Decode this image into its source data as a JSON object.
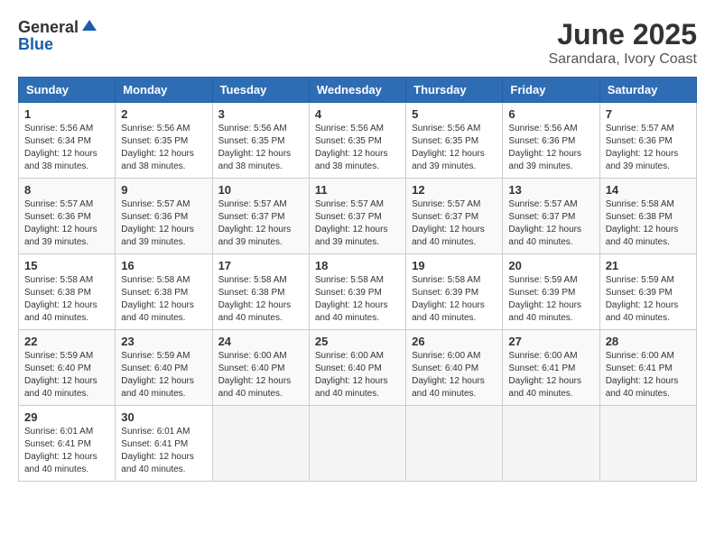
{
  "header": {
    "logo_general": "General",
    "logo_blue": "Blue",
    "title": "June 2025",
    "subtitle": "Sarandara, Ivory Coast"
  },
  "calendar": {
    "days_of_week": [
      "Sunday",
      "Monday",
      "Tuesday",
      "Wednesday",
      "Thursday",
      "Friday",
      "Saturday"
    ],
    "weeks": [
      [
        {
          "day": "1",
          "info": "Sunrise: 5:56 AM\nSunset: 6:34 PM\nDaylight: 12 hours\nand 38 minutes."
        },
        {
          "day": "2",
          "info": "Sunrise: 5:56 AM\nSunset: 6:35 PM\nDaylight: 12 hours\nand 38 minutes."
        },
        {
          "day": "3",
          "info": "Sunrise: 5:56 AM\nSunset: 6:35 PM\nDaylight: 12 hours\nand 38 minutes."
        },
        {
          "day": "4",
          "info": "Sunrise: 5:56 AM\nSunset: 6:35 PM\nDaylight: 12 hours\nand 38 minutes."
        },
        {
          "day": "5",
          "info": "Sunrise: 5:56 AM\nSunset: 6:35 PM\nDaylight: 12 hours\nand 39 minutes."
        },
        {
          "day": "6",
          "info": "Sunrise: 5:56 AM\nSunset: 6:36 PM\nDaylight: 12 hours\nand 39 minutes."
        },
        {
          "day": "7",
          "info": "Sunrise: 5:57 AM\nSunset: 6:36 PM\nDaylight: 12 hours\nand 39 minutes."
        }
      ],
      [
        {
          "day": "8",
          "info": "Sunrise: 5:57 AM\nSunset: 6:36 PM\nDaylight: 12 hours\nand 39 minutes."
        },
        {
          "day": "9",
          "info": "Sunrise: 5:57 AM\nSunset: 6:36 PM\nDaylight: 12 hours\nand 39 minutes."
        },
        {
          "day": "10",
          "info": "Sunrise: 5:57 AM\nSunset: 6:37 PM\nDaylight: 12 hours\nand 39 minutes."
        },
        {
          "day": "11",
          "info": "Sunrise: 5:57 AM\nSunset: 6:37 PM\nDaylight: 12 hours\nand 39 minutes."
        },
        {
          "day": "12",
          "info": "Sunrise: 5:57 AM\nSunset: 6:37 PM\nDaylight: 12 hours\nand 40 minutes."
        },
        {
          "day": "13",
          "info": "Sunrise: 5:57 AM\nSunset: 6:37 PM\nDaylight: 12 hours\nand 40 minutes."
        },
        {
          "day": "14",
          "info": "Sunrise: 5:58 AM\nSunset: 6:38 PM\nDaylight: 12 hours\nand 40 minutes."
        }
      ],
      [
        {
          "day": "15",
          "info": "Sunrise: 5:58 AM\nSunset: 6:38 PM\nDaylight: 12 hours\nand 40 minutes."
        },
        {
          "day": "16",
          "info": "Sunrise: 5:58 AM\nSunset: 6:38 PM\nDaylight: 12 hours\nand 40 minutes."
        },
        {
          "day": "17",
          "info": "Sunrise: 5:58 AM\nSunset: 6:38 PM\nDaylight: 12 hours\nand 40 minutes."
        },
        {
          "day": "18",
          "info": "Sunrise: 5:58 AM\nSunset: 6:39 PM\nDaylight: 12 hours\nand 40 minutes."
        },
        {
          "day": "19",
          "info": "Sunrise: 5:58 AM\nSunset: 6:39 PM\nDaylight: 12 hours\nand 40 minutes."
        },
        {
          "day": "20",
          "info": "Sunrise: 5:59 AM\nSunset: 6:39 PM\nDaylight: 12 hours\nand 40 minutes."
        },
        {
          "day": "21",
          "info": "Sunrise: 5:59 AM\nSunset: 6:39 PM\nDaylight: 12 hours\nand 40 minutes."
        }
      ],
      [
        {
          "day": "22",
          "info": "Sunrise: 5:59 AM\nSunset: 6:40 PM\nDaylight: 12 hours\nand 40 minutes."
        },
        {
          "day": "23",
          "info": "Sunrise: 5:59 AM\nSunset: 6:40 PM\nDaylight: 12 hours\nand 40 minutes."
        },
        {
          "day": "24",
          "info": "Sunrise: 6:00 AM\nSunset: 6:40 PM\nDaylight: 12 hours\nand 40 minutes."
        },
        {
          "day": "25",
          "info": "Sunrise: 6:00 AM\nSunset: 6:40 PM\nDaylight: 12 hours\nand 40 minutes."
        },
        {
          "day": "26",
          "info": "Sunrise: 6:00 AM\nSunset: 6:40 PM\nDaylight: 12 hours\nand 40 minutes."
        },
        {
          "day": "27",
          "info": "Sunrise: 6:00 AM\nSunset: 6:41 PM\nDaylight: 12 hours\nand 40 minutes."
        },
        {
          "day": "28",
          "info": "Sunrise: 6:00 AM\nSunset: 6:41 PM\nDaylight: 12 hours\nand 40 minutes."
        }
      ],
      [
        {
          "day": "29",
          "info": "Sunrise: 6:01 AM\nSunset: 6:41 PM\nDaylight: 12 hours\nand 40 minutes."
        },
        {
          "day": "30",
          "info": "Sunrise: 6:01 AM\nSunset: 6:41 PM\nDaylight: 12 hours\nand 40 minutes."
        },
        {
          "day": "",
          "info": ""
        },
        {
          "day": "",
          "info": ""
        },
        {
          "day": "",
          "info": ""
        },
        {
          "day": "",
          "info": ""
        },
        {
          "day": "",
          "info": ""
        }
      ]
    ]
  }
}
